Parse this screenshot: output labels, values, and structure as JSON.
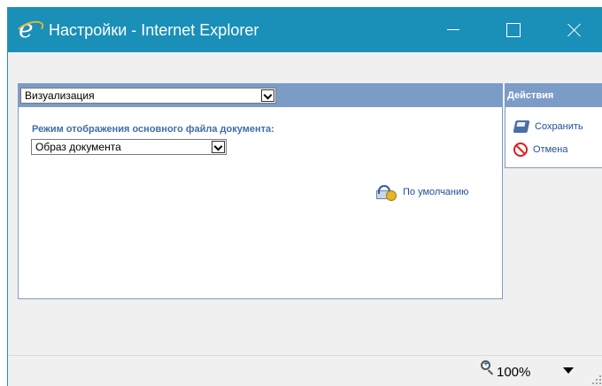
{
  "window": {
    "title": "Настройки - Internet Explorer",
    "logo_glyph": "e",
    "titlebar_color": "#1a8fb8"
  },
  "main": {
    "section_select": {
      "value": "Визуализация"
    },
    "mode_label": "Режим отображения основного файла документа:",
    "mode_select": {
      "value": "Образ документа"
    },
    "default_link": "По умолчанию",
    "header_color": "#7c9cc8"
  },
  "actions": {
    "title": "Действия",
    "save": "Сохранить",
    "cancel": "Отмена"
  },
  "statusbar": {
    "zoom": "100%"
  },
  "icons": [
    "ie-logo-icon",
    "minimize-icon",
    "maximize-icon",
    "close-icon",
    "dropdown-arrow-icon",
    "reset-default-icon",
    "floppy-save-icon",
    "cancel-forbid-icon",
    "zoom-icon",
    "chevron-down-icon",
    "resize-grip-icon"
  ]
}
